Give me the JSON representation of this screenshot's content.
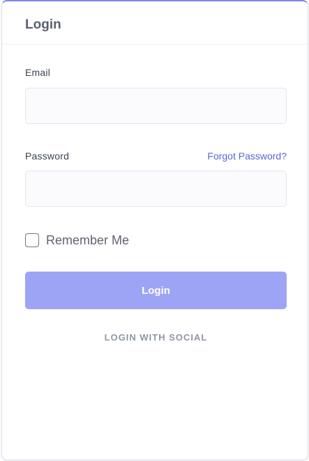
{
  "card": {
    "title": "Login"
  },
  "form": {
    "email_label": "Email",
    "email_value": "",
    "email_placeholder": "",
    "password_label": "Password",
    "forgot_password_label": "Forgot Password?",
    "password_value": "",
    "password_placeholder": "",
    "remember_me_label": "Remember Me",
    "remember_me_checked": false,
    "login_button_label": "Login",
    "social_login_label": "LOGIN WITH SOCIAL"
  },
  "colors": {
    "accent": "#7c84ea",
    "button_bg": "#9ea4f5",
    "link": "#5b66d6"
  }
}
